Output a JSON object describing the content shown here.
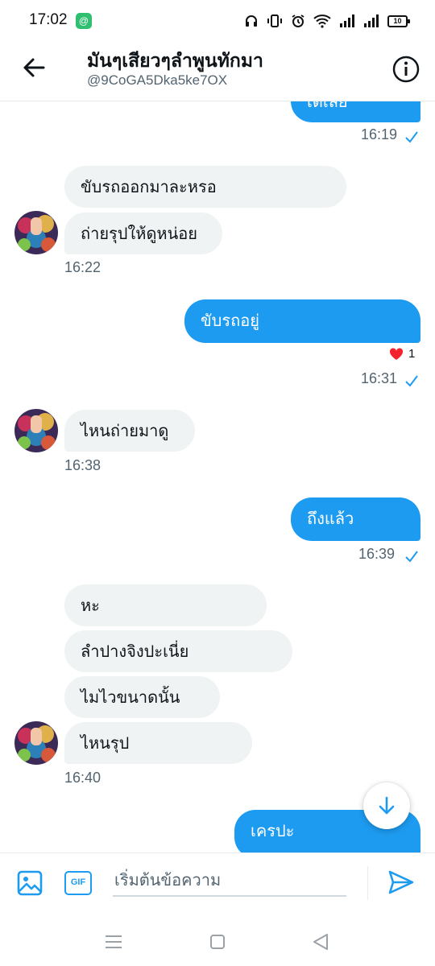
{
  "status_bar": {
    "time": "17:02",
    "app_badge": "@",
    "battery": "10"
  },
  "header": {
    "title": "มันๆเสียวๆลำพูนทักมา",
    "handle": "@9CoGA5Dka5ke7OX",
    "back_icon": "arrow-left-icon",
    "info_icon": "info-circle-icon"
  },
  "messages": {
    "partial_out": "เดิเลย",
    "time_1619": "16:19",
    "in_1": "ขับรถออกมาละหรอ",
    "in_2": "ถ่ายรุปให้ดูหน่อย",
    "time_1622": "16:22",
    "out_1": "ขับรถอยู่",
    "reaction_count": "1",
    "time_1631": "16:31",
    "in_3": "ไหนถ่ายมาดู",
    "time_1638": "16:38",
    "out_2": "ถึงแล้ว",
    "time_1639": "16:39",
    "in_4": "หะ",
    "in_5": "ลำปางจิงปะเนี่ย",
    "in_6": "ไมไวขนาดนั้น",
    "in_7": "ไหนรุป",
    "time_1640": "16:40",
    "out_3": "เครปะ"
  },
  "composer": {
    "placeholder": "เริ่มต้นข้อความ",
    "gif_label": "GIF"
  },
  "colors": {
    "accent": "#1d9bf0",
    "incoming_bubble": "#eff3f4",
    "muted_text": "#536471",
    "heart": "#f4212e"
  }
}
